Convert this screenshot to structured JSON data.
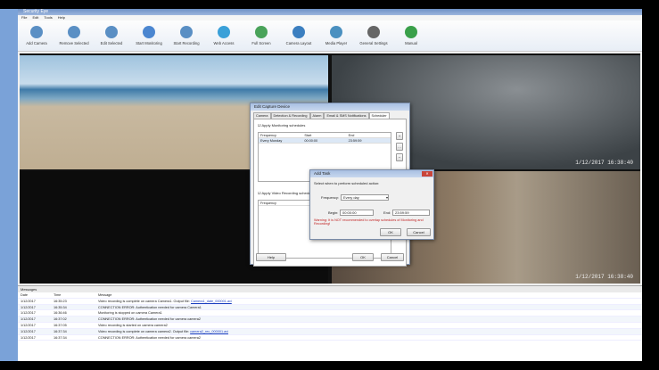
{
  "window": {
    "title": "Security Eye",
    "menu": [
      "File",
      "Edit",
      "Tools",
      "Help"
    ]
  },
  "toolbar": [
    {
      "label": "Add Camera",
      "color": "#5a8fc4"
    },
    {
      "label": "Remove Selected",
      "color": "#5a8fc4"
    },
    {
      "label": "Edit Selected",
      "color": "#5a8fc4"
    },
    {
      "label": "Start Monitoring",
      "color": "#4b86d0"
    },
    {
      "label": "Start Recording",
      "color": "#5a8fc4"
    },
    {
      "label": "Web Access",
      "color": "#3aa0d8"
    },
    {
      "label": "Full Screen",
      "color": "#4aa35a"
    },
    {
      "label": "Camera Layout",
      "color": "#3b7fc0"
    },
    {
      "label": "Media Player",
      "color": "#4a90c0"
    },
    {
      "label": "General Settings",
      "color": "#666666"
    },
    {
      "label": "Manual",
      "color": "#3aa04a"
    }
  ],
  "cameras": [
    {
      "timestamp": ""
    },
    {
      "timestamp": "1/12/2017 16:38:40"
    },
    {
      "timestamp": ""
    },
    {
      "timestamp": "1/12/2017 16:38:40"
    }
  ],
  "edit_dialog": {
    "title": "Edit Capture Device",
    "tabs": [
      "Camera",
      "Detection & Recording",
      "Alarm",
      "Email & SMS Notifications",
      "Scheduler"
    ],
    "active_tab": "Scheduler",
    "monitoring_check": "Apply Monitoring schedules",
    "columns": [
      "Frequency",
      "Start",
      "End"
    ],
    "rows": [
      [
        "Every Monday",
        "00:00:00",
        "23:59:59"
      ]
    ],
    "recording_check": "Apply Video Recording schedules",
    "rec_columns": [
      "Frequency"
    ],
    "help": "Help",
    "ok": "OK",
    "cancel": "Cancel"
  },
  "add_task": {
    "title": "Add Task",
    "prompt": "Select when to perform scheduled action:",
    "frequency_label": "Frequency:",
    "frequency_value": "Every day",
    "begin_label": "Begin:",
    "begin_value": "00:00:00",
    "end_label": "End:",
    "end_value": "23:59:59",
    "warning": "Warning: It is NOT recommended to overlap schedules of Monitoring and Recording!",
    "ok": "OK",
    "cancel": "Cancel"
  },
  "messages": {
    "title": "Messages",
    "columns": [
      "Date",
      "Time",
      "Message"
    ],
    "rows": [
      {
        "date": "1/12/2017",
        "time": "16:35:23",
        "msg": "Video recording is complete on camera Camera1. Output file:",
        "link": "Camera1_date_000001.avi"
      },
      {
        "date": "1/12/2017",
        "time": "16:35:34",
        "msg": "CONNECTION ERROR: Authentication needed for camera Camera1",
        "link": ""
      },
      {
        "date": "1/12/2017",
        "time": "16:36:46",
        "msg": "Monitoring is stopped on camera Camera1",
        "link": ""
      },
      {
        "date": "1/12/2017",
        "time": "16:37:02",
        "msg": "CONNECTION ERROR: Authentication needed for camera camera2",
        "link": ""
      },
      {
        "date": "1/12/2017",
        "time": "16:37:05",
        "msg": "Video recording is started on camera camera2",
        "link": ""
      },
      {
        "date": "1/12/2017",
        "time": "16:37:34",
        "msg": "Video recording is complete on camera camera2. Output file:",
        "link": "camera2_rec_000001.avi"
      },
      {
        "date": "1/12/2017",
        "time": "16:37:34",
        "msg": "CONNECTION ERROR: Authentication needed for camera camera2",
        "link": ""
      }
    ]
  }
}
